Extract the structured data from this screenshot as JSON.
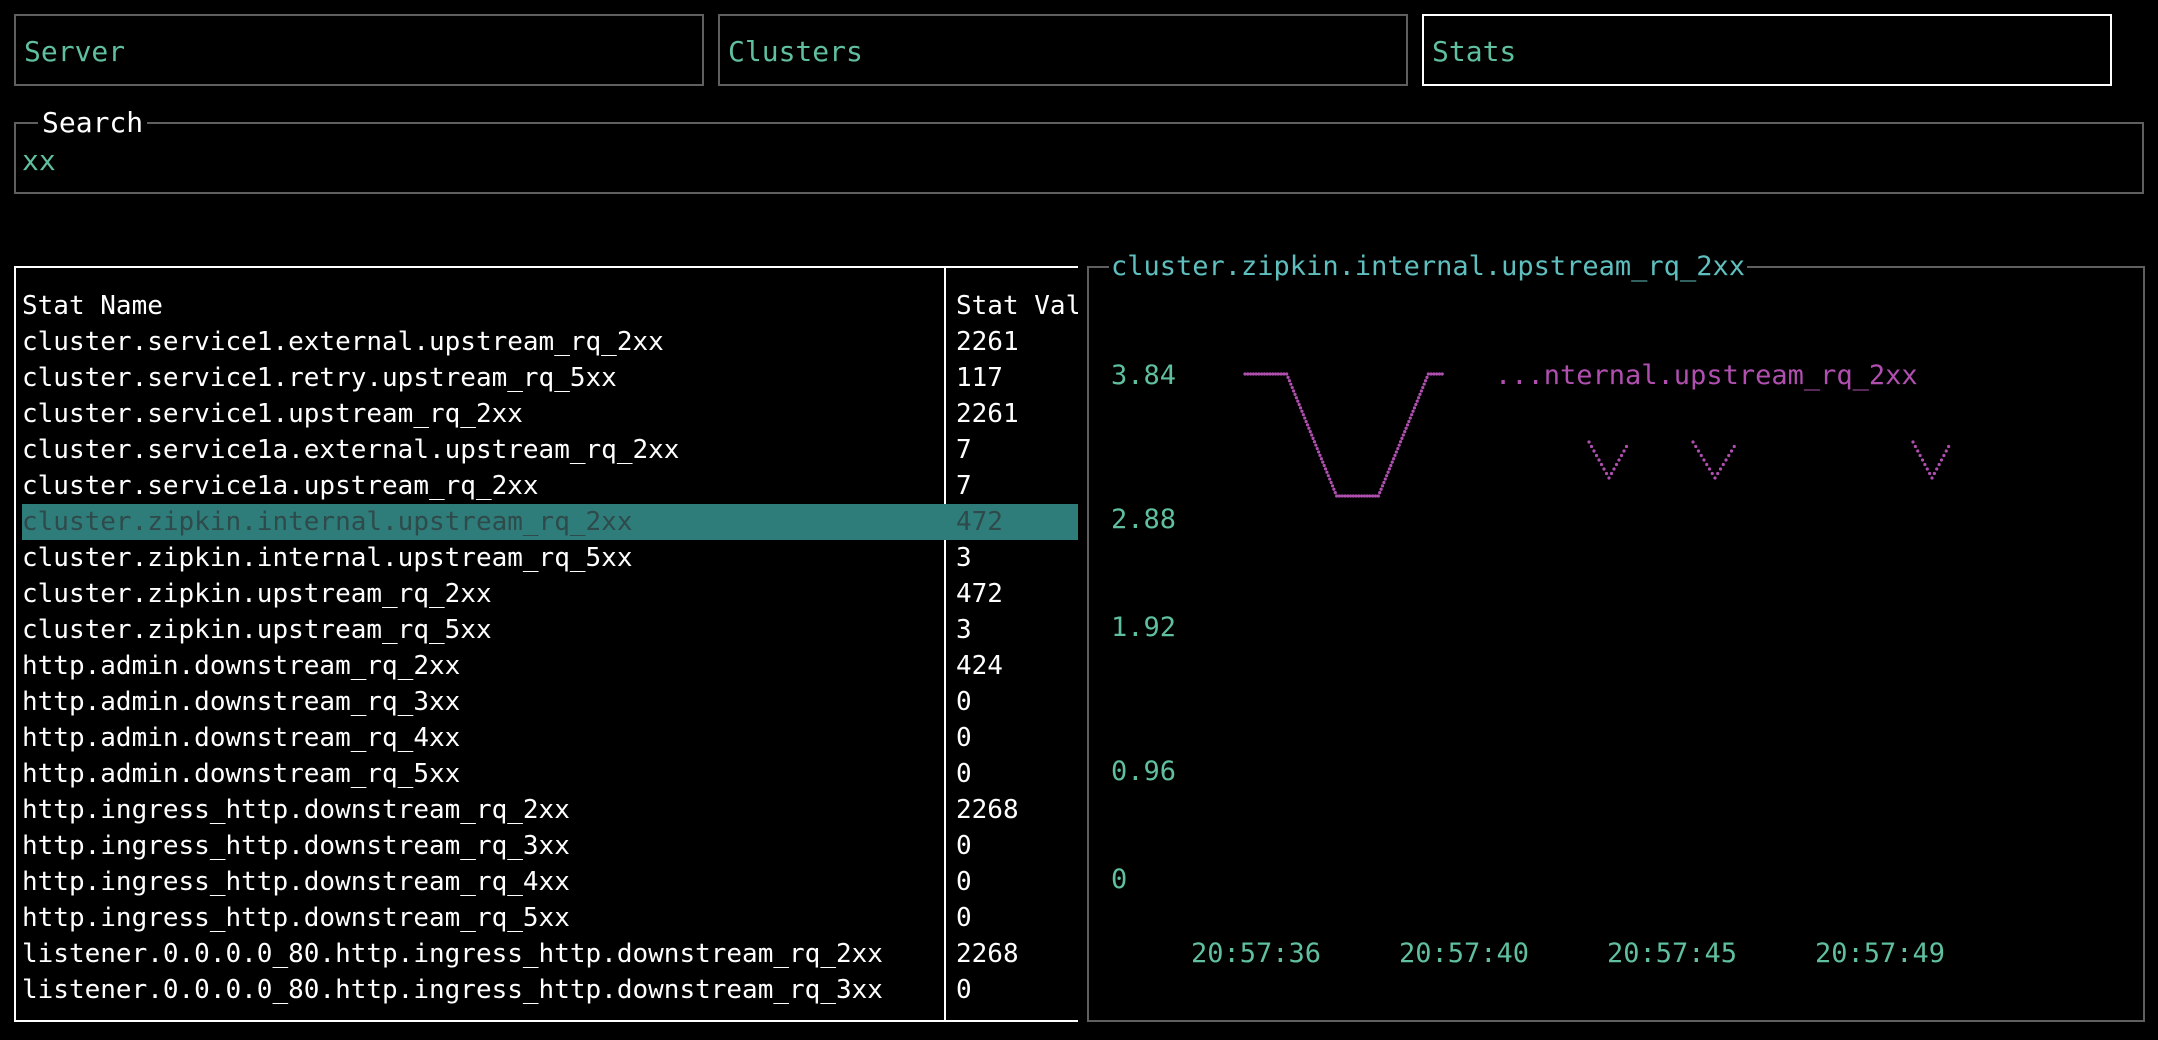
{
  "tabs": [
    {
      "label": "Server",
      "active": false
    },
    {
      "label": "Clusters",
      "active": false
    },
    {
      "label": "Stats",
      "active": true
    }
  ],
  "search": {
    "title": "Search",
    "value": "xx"
  },
  "table": {
    "headers": {
      "name": "Stat Name",
      "value": "Stat Val"
    },
    "selected_index": 5,
    "rows": [
      {
        "name": "cluster.service1.external.upstream_rq_2xx",
        "value": "2261"
      },
      {
        "name": "cluster.service1.retry.upstream_rq_5xx",
        "value": "117"
      },
      {
        "name": "cluster.service1.upstream_rq_2xx",
        "value": "2261"
      },
      {
        "name": "cluster.service1a.external.upstream_rq_2xx",
        "value": "7"
      },
      {
        "name": "cluster.service1a.upstream_rq_2xx",
        "value": "7"
      },
      {
        "name": "cluster.zipkin.internal.upstream_rq_2xx",
        "value": "472"
      },
      {
        "name": "cluster.zipkin.internal.upstream_rq_5xx",
        "value": "3"
      },
      {
        "name": "cluster.zipkin.upstream_rq_2xx",
        "value": "472"
      },
      {
        "name": "cluster.zipkin.upstream_rq_5xx",
        "value": "3"
      },
      {
        "name": "http.admin.downstream_rq_2xx",
        "value": "424"
      },
      {
        "name": "http.admin.downstream_rq_3xx",
        "value": "0"
      },
      {
        "name": "http.admin.downstream_rq_4xx",
        "value": "0"
      },
      {
        "name": "http.admin.downstream_rq_5xx",
        "value": "0"
      },
      {
        "name": "http.ingress_http.downstream_rq_2xx",
        "value": "2268"
      },
      {
        "name": "http.ingress_http.downstream_rq_3xx",
        "value": "0"
      },
      {
        "name": "http.ingress_http.downstream_rq_4xx",
        "value": "0"
      },
      {
        "name": "http.ingress_http.downstream_rq_5xx",
        "value": "0"
      },
      {
        "name": "listener.0.0.0.0_80.http.ingress_http.downstream_rq_2xx",
        "value": "2268"
      },
      {
        "name": "listener.0.0.0.0_80.http.ingress_http.downstream_rq_3xx",
        "value": "0"
      }
    ]
  },
  "graph": {
    "title": "cluster.zipkin.internal.upstream_rq_2xx",
    "legend": "...nternal.upstream_rq_2xx",
    "series_color": "#b04fb0",
    "axis_color": "#5fbf9f"
  },
  "chart_data": {
    "type": "line",
    "title": "cluster.zipkin.internal.upstream_rq_2xx",
    "series": [
      {
        "name": "...nternal.upstream_rq_2xx",
        "values": [
          3.84,
          3.84,
          3.84,
          3.84,
          3.84,
          3.84,
          3.72,
          3.6,
          3.48,
          3.36,
          3.24,
          3.12,
          3.12,
          3.12,
          3.12,
          3.12,
          3.12,
          3.24,
          3.36,
          3.48,
          3.6,
          3.72,
          3.84,
          3.84,
          3.84
        ]
      }
    ],
    "y_ticks": [
      "3.84",
      "2.88",
      "1.92",
      "0.96",
      "0"
    ],
    "x_ticks": [
      "20:57:36",
      "20:57:40",
      "20:57:45",
      "20:57:49"
    ],
    "ylim": [
      0,
      3.84
    ]
  }
}
